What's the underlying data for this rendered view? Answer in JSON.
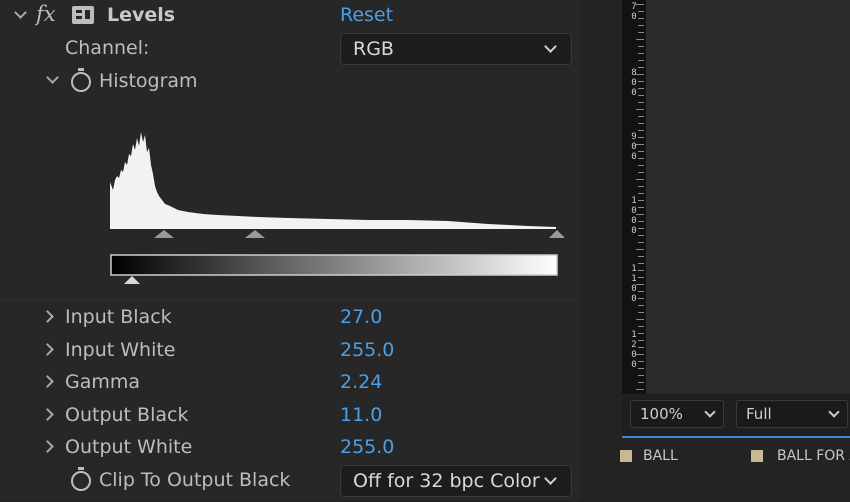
{
  "effect": {
    "name": "Levels",
    "fx_symbol": "fx",
    "reset_label": "Reset"
  },
  "channel": {
    "label": "Channel:",
    "value": "RGB"
  },
  "histogram": {
    "label": "Histogram"
  },
  "params": [
    {
      "label": "Input Black",
      "value": "27.0"
    },
    {
      "label": "Input White",
      "value": "255.0"
    },
    {
      "label": "Gamma",
      "value": "2.24"
    },
    {
      "label": "Output Black",
      "value": "11.0"
    },
    {
      "label": "Output White",
      "value": "255.0"
    }
  ],
  "clip": {
    "label": "Clip To Output Black",
    "value": "Off for 32 bpc Color"
  },
  "ruler": {
    "labels": [
      "70",
      "800",
      "900",
      "1000",
      "1100",
      "1200"
    ]
  },
  "viewer": {
    "zoom": "100%",
    "resolution": "Full"
  },
  "timeline": {
    "tabs": [
      "BALL",
      "BALL FOR A"
    ]
  },
  "colors": {
    "accent": "#4c9fe7",
    "panel_bg": "#272727",
    "tab_swatch": "#c9b895",
    "timeline_highlight": "#3b8ad9"
  }
}
